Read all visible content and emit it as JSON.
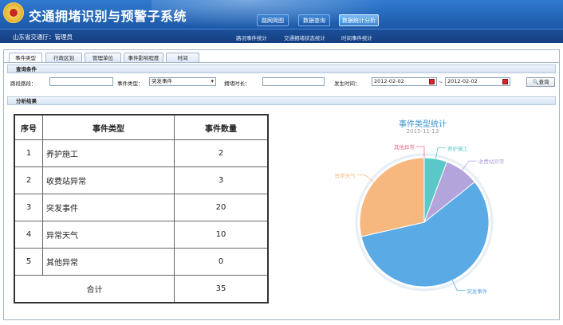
{
  "app_title": "交通拥堵识别与预警子系统",
  "top_nav": [
    "路网简图",
    "数据查询",
    "数据统计分析"
  ],
  "user_info": "山东省交通厅：管理员",
  "sub_nav": [
    "路况事件统计",
    "交通拥堵状态统计",
    "时间事件统计"
  ],
  "tabs": [
    "事件类型",
    "行政区划",
    "管理单位",
    "事件影响程度",
    "时间"
  ],
  "query": {
    "section_title": "查询条件",
    "road_label": "路段路段：",
    "road_value": "",
    "event_type_label": "事件类型：",
    "event_type_value": "突发事件",
    "duration_label": "拥堵时长：",
    "duration_value": "",
    "time_label": "发生时间：",
    "start_date": "2012-02-02",
    "date_sep": "~",
    "end_date": "2012-02-02",
    "query_button": "查询"
  },
  "results_title": "分析结果",
  "table": {
    "headers": [
      "序号",
      "事件类型",
      "事件数量"
    ],
    "rows": [
      {
        "no": "1",
        "type": "养护施工",
        "count": "2"
      },
      {
        "no": "2",
        "type": "收费站异常",
        "count": "3"
      },
      {
        "no": "3",
        "type": "突发事件",
        "count": "20"
      },
      {
        "no": "4",
        "type": "异常天气",
        "count": "10"
      },
      {
        "no": "5",
        "type": "其他异常",
        "count": "0"
      }
    ],
    "total_label": "合计",
    "total_value": "35"
  },
  "chart_data": {
    "type": "pie",
    "title": "事件类型统计",
    "subtitle": "2015-11-13",
    "slices": [
      {
        "label": "养护施工",
        "value": 2,
        "color": "#5ac8c8"
      },
      {
        "label": "收费站异常",
        "value": 3,
        "color": "#b3a4dc"
      },
      {
        "label": "突发事件",
        "value": 20,
        "color": "#5aaae6"
      },
      {
        "label": "异常天气",
        "value": 10,
        "color": "#f7b880"
      },
      {
        "label": "其他异常",
        "value": 0,
        "color": "#e8708a"
      }
    ]
  }
}
